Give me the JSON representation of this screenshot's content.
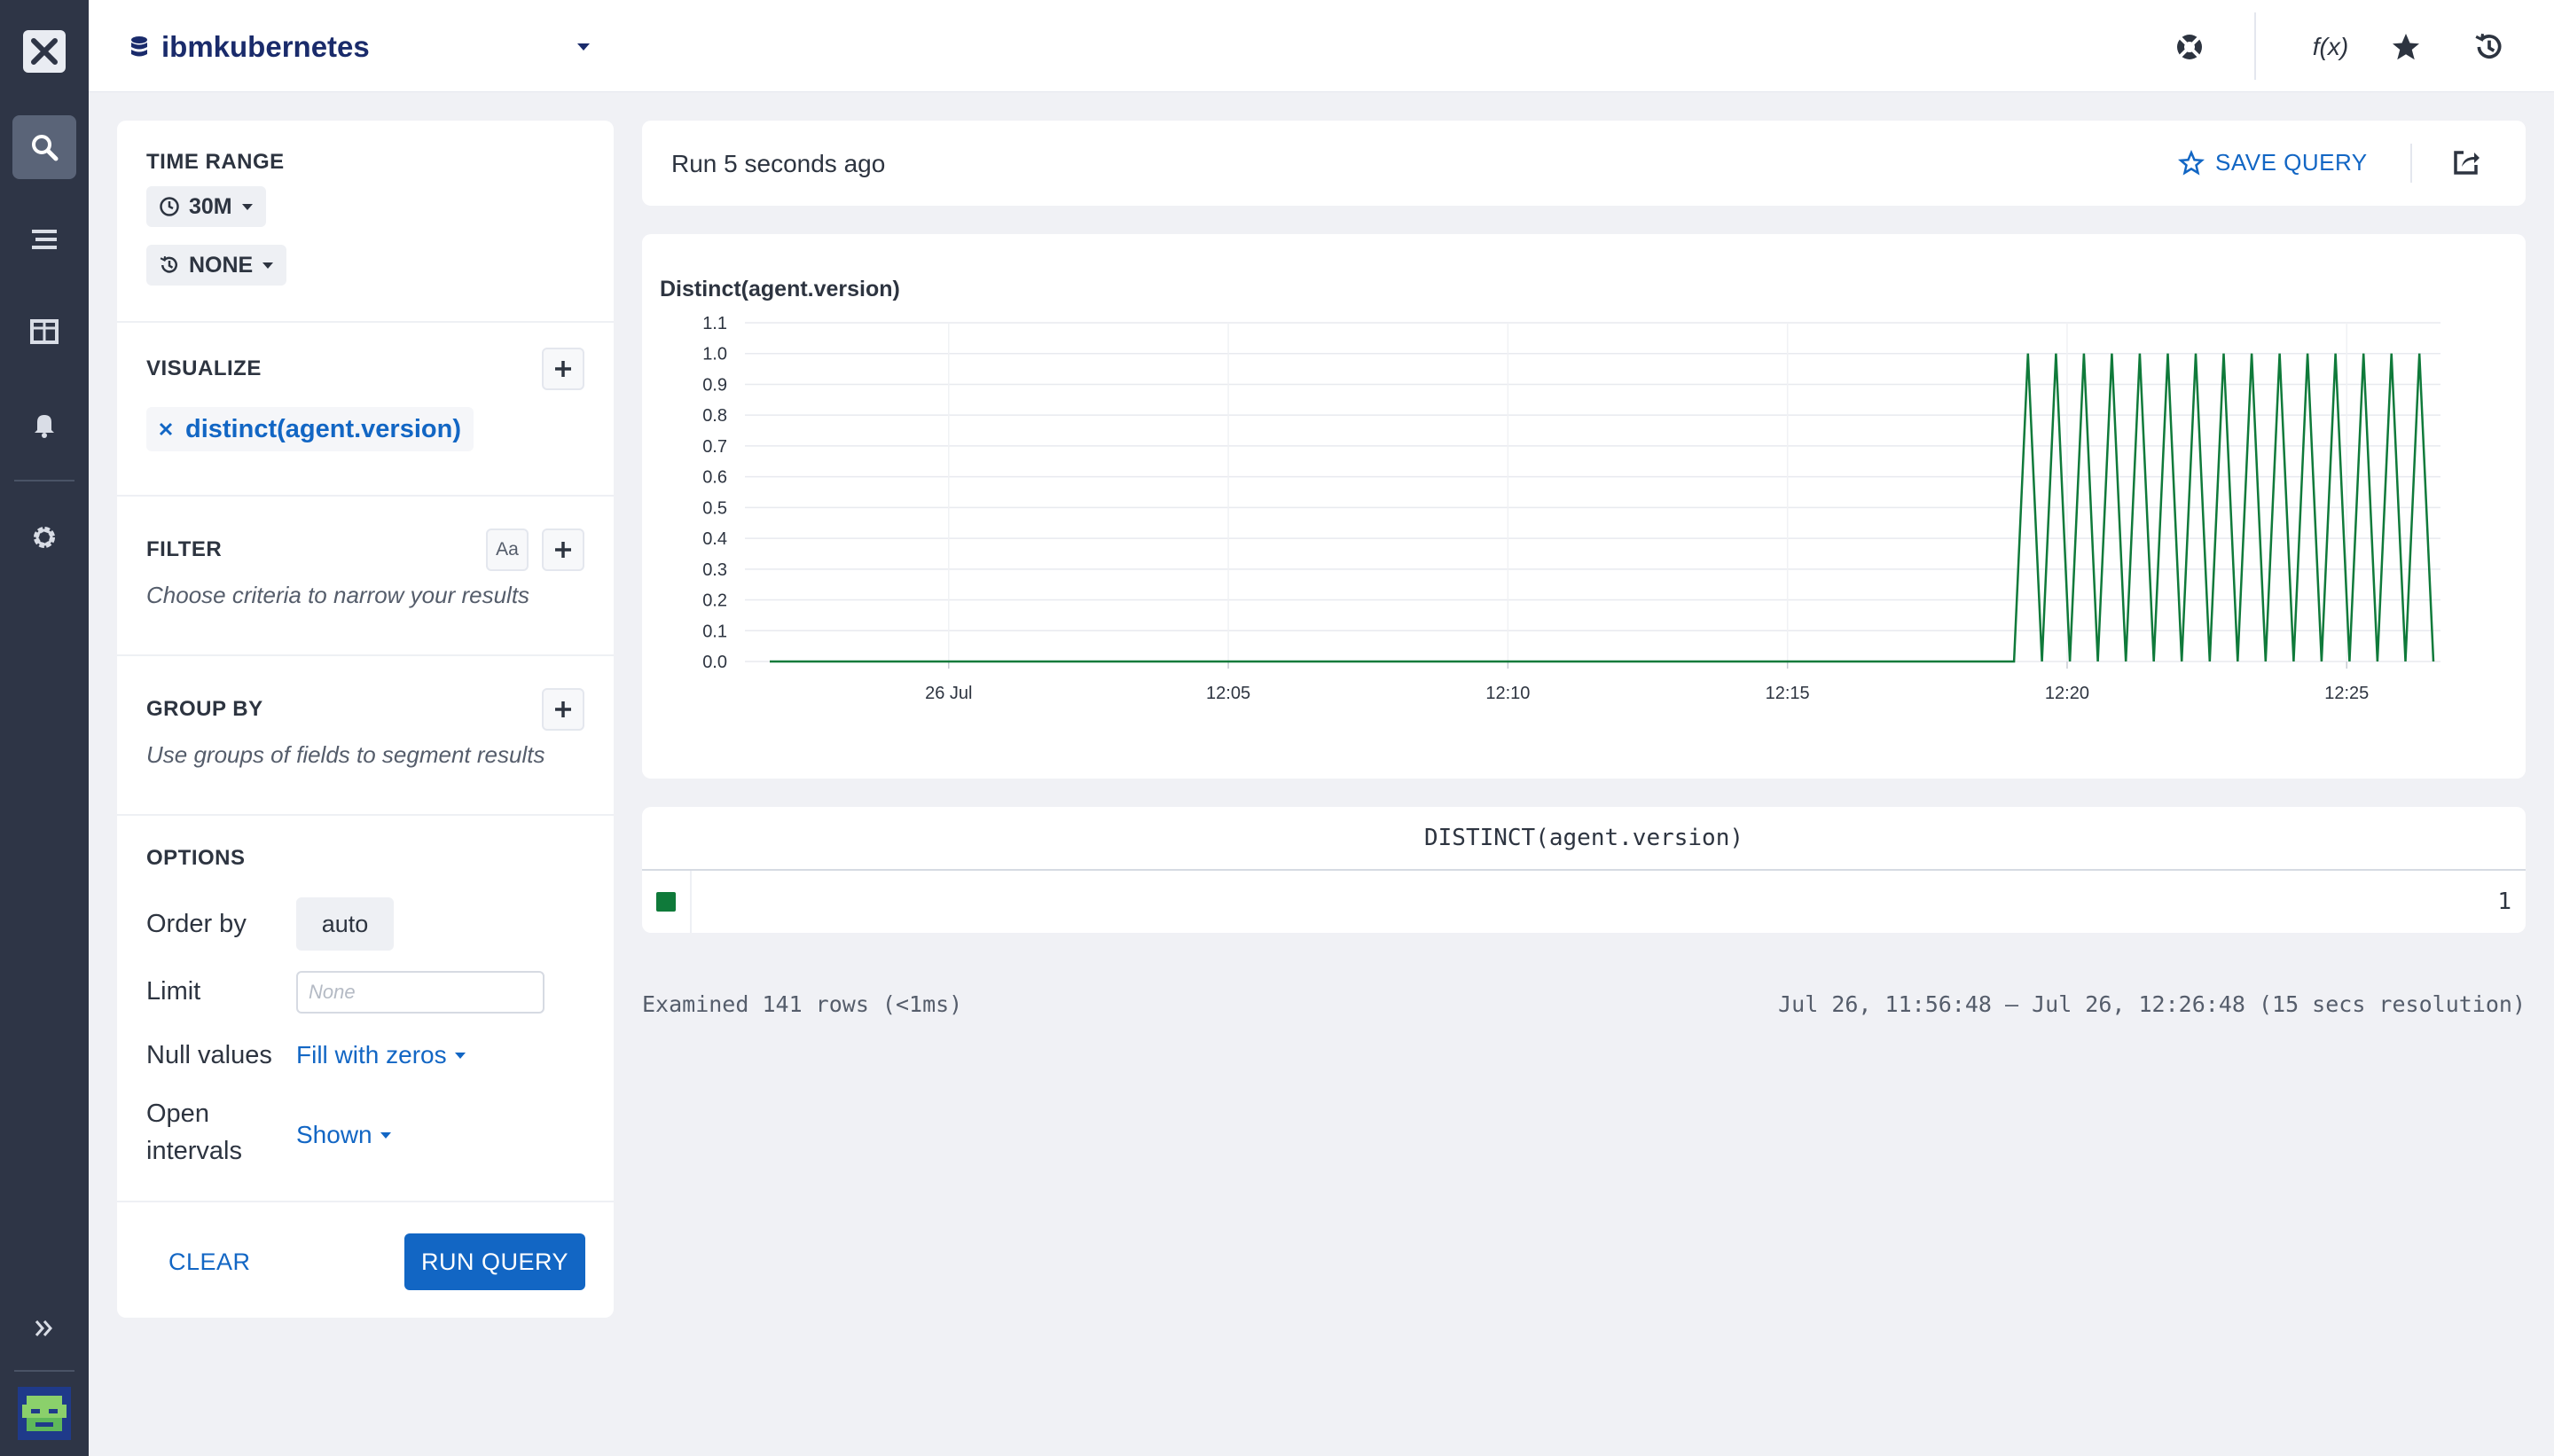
{
  "header": {
    "dataset_name": "ibmkubernetes",
    "icons": [
      "help-lifebuoy-icon",
      "function-icon",
      "star-icon",
      "history-icon"
    ],
    "function_icon_label": "f(x)"
  },
  "nav": {
    "items": [
      "search-icon",
      "streams-icon",
      "dashboards-icon",
      "monitors-bell-icon",
      "settings-gear-icon"
    ],
    "expand_icon": "double-chevron-right-icon"
  },
  "sidebar": {
    "time_range": {
      "title": "TIME RANGE",
      "range_value": "30M",
      "compare_value": "NONE"
    },
    "visualize": {
      "title": "VISUALIZE",
      "items": [
        {
          "label": "distinct(agent.version)"
        }
      ]
    },
    "filter": {
      "title": "FILTER",
      "case_toggle": "Aa",
      "hint": "Choose criteria to narrow your results"
    },
    "group_by": {
      "title": "GROUP BY",
      "hint": "Use groups of fields to segment results"
    },
    "options": {
      "title": "OPTIONS",
      "order_by": {
        "label": "Order by",
        "value": "auto"
      },
      "limit": {
        "label": "Limit",
        "placeholder": "None"
      },
      "null_values": {
        "label": "Null values",
        "value": "Fill with zeros"
      },
      "open_intervals": {
        "label_line1": "Open",
        "label_line2": "intervals",
        "value": "Shown"
      }
    },
    "clear_label": "CLEAR",
    "run_label": "RUN QUERY"
  },
  "runbar": {
    "run_text": "Run 5 seconds ago",
    "save_label": "SAVE QUERY"
  },
  "colors": {
    "accent": "#1266c4",
    "series": "#0f7a3a",
    "nav_bg": "#2e3546"
  },
  "chart_data": {
    "type": "line",
    "title": "Distinct(agent.version)",
    "xlabel": "",
    "ylabel": "",
    "ylim": [
      0,
      1.1
    ],
    "y_ticks": [
      "0.0",
      "0.1",
      "0.2",
      "0.3",
      "0.4",
      "0.5",
      "0.6",
      "0.7",
      "0.8",
      "0.9",
      "1.0",
      "1.1"
    ],
    "x_tick_labels": [
      "26 Jul",
      "12:05",
      "12:10",
      "12:15",
      "12:20",
      "12:25"
    ],
    "grid": true,
    "series": [
      {
        "x_start": "11:56:48",
        "step_seconds": 15,
        "values": [
          0,
          0,
          0,
          0,
          0,
          0,
          0,
          0,
          0,
          0,
          0,
          0,
          0,
          0,
          0,
          0,
          0,
          0,
          0,
          0,
          0,
          0,
          0,
          0,
          0,
          0,
          0,
          0,
          0,
          0,
          0,
          0,
          0,
          0,
          0,
          0,
          0,
          0,
          0,
          0,
          0,
          0,
          0,
          0,
          0,
          0,
          0,
          0,
          0,
          0,
          0,
          0,
          0,
          0,
          0,
          0,
          0,
          0,
          0,
          0,
          0,
          0,
          0,
          0,
          0,
          0,
          0,
          0,
          0,
          0,
          0,
          0,
          0,
          0,
          0,
          0,
          0,
          0,
          0,
          0,
          0,
          0,
          0,
          0,
          0,
          0,
          0,
          0,
          0,
          0,
          1,
          0,
          1,
          0,
          1,
          0,
          1,
          0,
          1,
          0,
          1,
          0,
          1,
          0,
          1,
          0,
          1,
          0,
          1,
          0,
          1,
          0,
          1,
          0,
          1,
          0,
          1,
          0,
          1,
          0
        ]
      }
    ]
  },
  "table": {
    "header": "DISTINCT(agent.version)",
    "rows": [
      {
        "value": "1"
      }
    ]
  },
  "footer": {
    "examined": "Examined 141 rows (<1ms)",
    "range": "Jul 26, 11:56:48 – Jul 26, 12:26:48 (15 secs resolution)"
  }
}
